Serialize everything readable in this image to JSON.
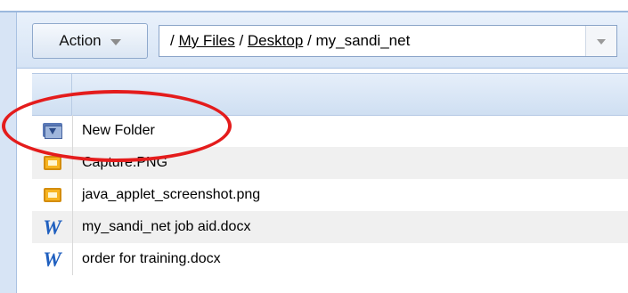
{
  "toolbar": {
    "action_label": "Action",
    "path": {
      "root": "/ ",
      "my_files": "My Files",
      "sep1": " / ",
      "desktop": "Desktop",
      "sep2": " / ",
      "current": "my_sandi_net"
    }
  },
  "files": [
    {
      "name": "New Folder",
      "icon": "folder-icon"
    },
    {
      "name": "Capture.PNG",
      "icon": "image-icon"
    },
    {
      "name": "java_applet_screenshot.png",
      "icon": "image-icon"
    },
    {
      "name": "my_sandi_net job aid.docx",
      "icon": "word-icon"
    },
    {
      "name": "order for training.docx",
      "icon": "word-icon"
    }
  ],
  "icons": {
    "word_glyph": "W"
  },
  "colors": {
    "highlight": "#e41c1c",
    "header_blue": "#cfdff2"
  }
}
